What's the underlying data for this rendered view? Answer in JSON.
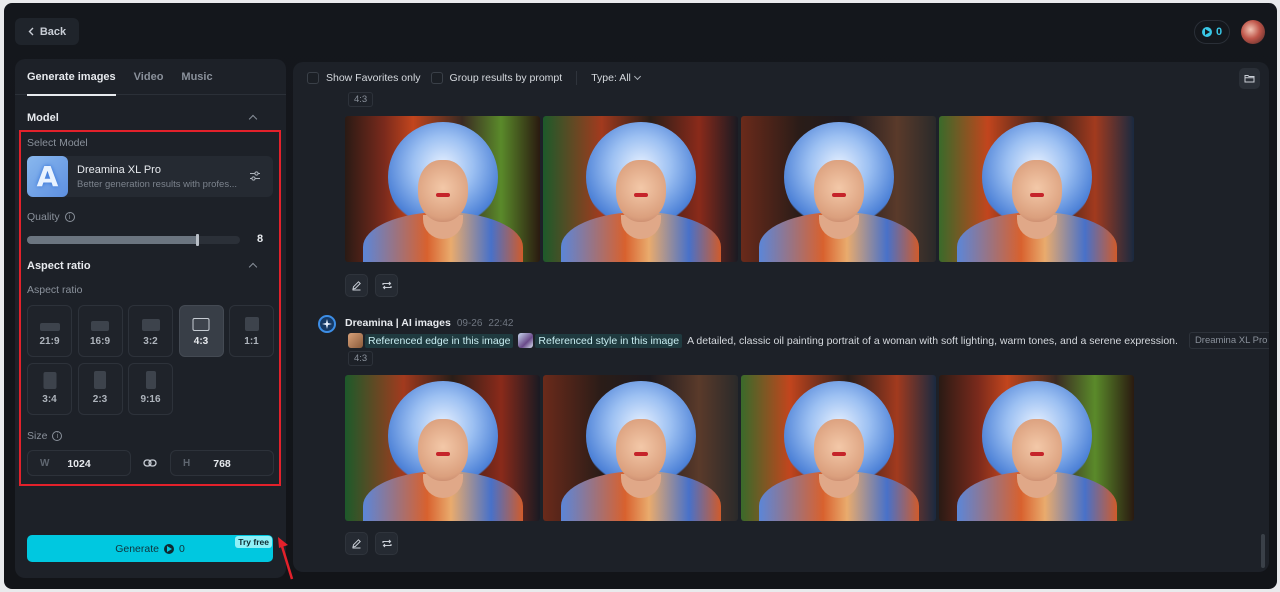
{
  "header": {
    "back_label": "Back",
    "credits": "0"
  },
  "left_panel": {
    "tabs": [
      {
        "label": "Generate images",
        "active": true
      },
      {
        "label": "Video",
        "active": false
      },
      {
        "label": "Music",
        "active": false
      }
    ],
    "model_section": {
      "title": "Model",
      "select_label": "Select Model",
      "model_name": "Dreamina XL Pro",
      "model_desc": "Better generation results with profes...",
      "logo_letter": "A"
    },
    "quality": {
      "label": "Quality",
      "value": "8",
      "fraction": 0.8
    },
    "aspect_section": {
      "title": "Aspect ratio",
      "label": "Aspect ratio",
      "options": [
        "21:9",
        "16:9",
        "3:2",
        "4:3",
        "1:1",
        "3:4",
        "2:3",
        "9:16"
      ],
      "selected": "4:3"
    },
    "size": {
      "label": "Size",
      "w_prefix": "W",
      "w_value": "1024",
      "h_prefix": "H",
      "h_value": "768"
    },
    "generate": {
      "label": "Generate",
      "cost": "0",
      "badge": "Try free",
      "color": "#00c8e0"
    }
  },
  "right_panel": {
    "filters": {
      "favorites_label": "Show Favorites only",
      "group_label": "Group results by prompt",
      "type_label": "Type: All"
    },
    "groups": [
      {
        "ratio_tag": "4:3",
        "images": 4
      },
      {
        "author": "Dreamina | AI images",
        "date": "09-26",
        "time": "22:42",
        "ref_edge": "Referenced edge in this image",
        "ref_style": "Referenced style in this image",
        "prompt": "A detailed, classic oil painting portrait of a woman with soft lighting, warm tones, and a serene expression.",
        "model_tag": "Dreamina XL Pro",
        "ratio_tag": "4:3",
        "images": 4
      }
    ]
  },
  "colors": {
    "accent": "#00c8e0",
    "highlight_box": "#e3212b",
    "panel_bg": "#1d2128",
    "app_bg": "#14171c"
  }
}
